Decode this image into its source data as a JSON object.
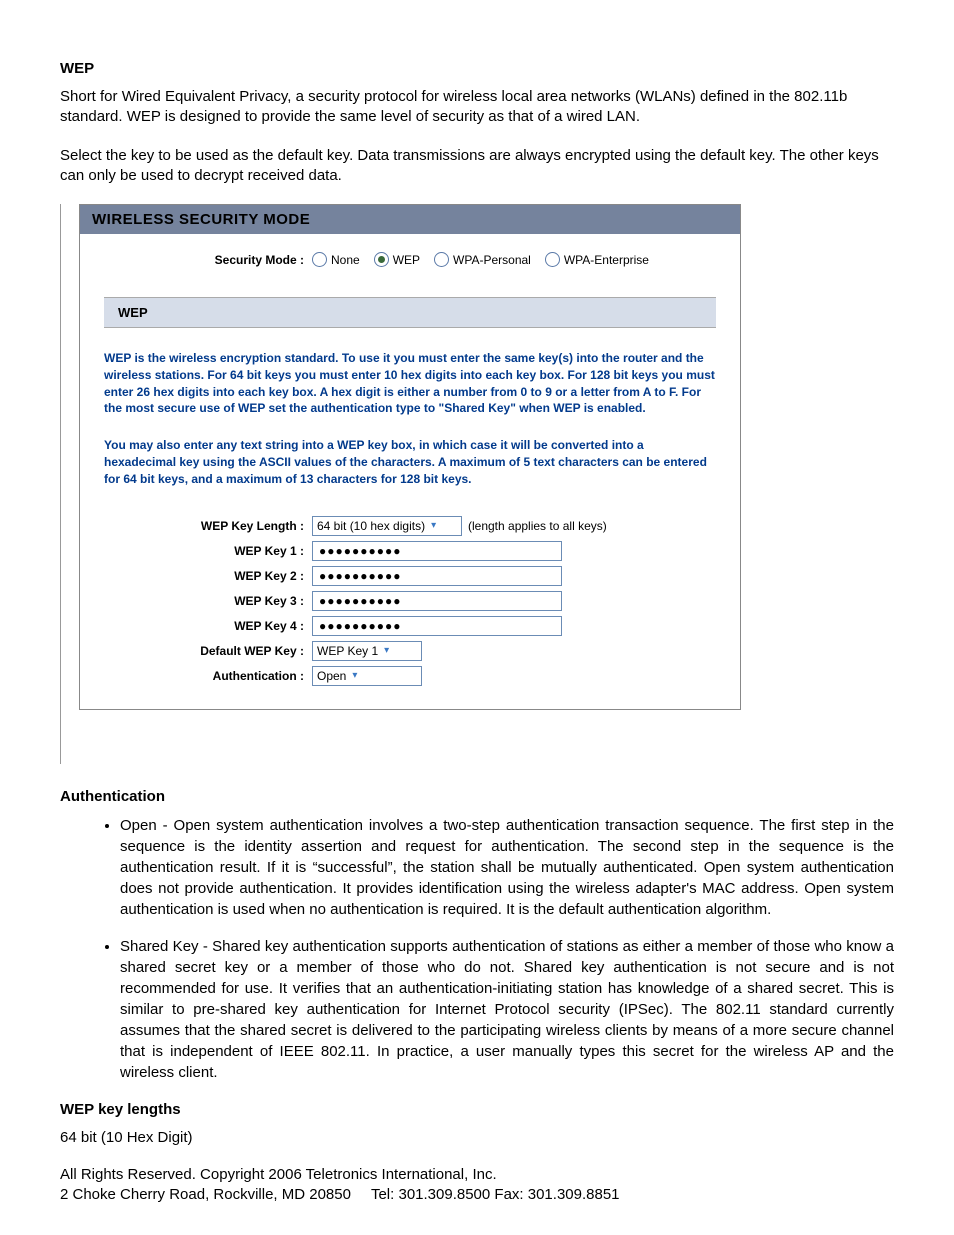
{
  "heading": "WEP",
  "intro1": "Short for Wired Equivalent Privacy, a security protocol for wireless local area networks (WLANs) defined in the 802.11b standard. WEP is designed to provide the same level of security as that of a wired LAN.",
  "intro2": "Select the key to be used as the default key. Data transmissions are always encrypted using the default key. The other keys can only be used to decrypt received data.",
  "panel": {
    "title": "WIRELESS SECURITY MODE",
    "modeLabel": "Security Mode :",
    "modes": {
      "none": "None",
      "wep": "WEP",
      "wpap": "WPA-Personal",
      "wpae": "WPA-Enterprise"
    },
    "section": "WEP",
    "info1": "WEP is the wireless encryption standard. To use it you must enter the same key(s) into the router and the wireless stations. For 64 bit keys you must enter 10 hex digits into each key box. For 128 bit keys you must enter 26 hex digits into each key box. A hex digit is either a number from 0 to 9 or a letter from A to F. For the most secure use of WEP set the authentication type to \"Shared Key\" when WEP is enabled.",
    "info2": "You may also enter any text string into a WEP key box, in which case it will be converted into a hexadecimal key using the ASCII values of the characters. A maximum of 5 text characters can be entered for 64 bit keys, and a maximum of 13 characters for 128 bit keys.",
    "form": {
      "lenLabel": "WEP Key Length :",
      "lenValue": "64 bit (10 hex digits)",
      "lenNote": "(length applies to all keys)",
      "k1Label": "WEP Key 1 :",
      "k1Value": "●●●●●●●●●●",
      "k2Label": "WEP Key 2 :",
      "k2Value": "●●●●●●●●●●",
      "k3Label": "WEP Key 3 :",
      "k3Value": "●●●●●●●●●●",
      "k4Label": "WEP Key 4 :",
      "k4Value": "●●●●●●●●●●",
      "defLabel": "Default WEP Key :",
      "defValue": "WEP Key 1",
      "authLabel": "Authentication :",
      "authValue": "Open"
    }
  },
  "auth": {
    "heading": "Authentication",
    "open": "Open - Open system authentication involves a two-step authentication transaction sequence. The first step in the sequence is the identity assertion and request for authentication. The second step in the sequence is the authentication result. If it is “successful”, the station shall be mutually authenticated. Open system authentication does not provide authentication. It provides identification using the wireless adapter's MAC address. Open system authentication is used when no authentication is required. It is the default authentication algorithm.",
    "shared": "Shared Key - Shared key authentication supports authentication of stations as either a member of those who know a shared secret key or a member of those who do not. Shared key authentication is not secure and is not recommended for use. It verifies that an authentication-initiating station has knowledge of a shared secret. This is similar to pre-shared key authentication for Internet Protocol security (IPSec). The 802.11 standard currently assumes that the shared secret is delivered to the participating wireless clients by means of a more secure channel that is independent of IEEE 802.11. In practice, a user manually types this secret for the wireless AP and the wireless client."
  },
  "keylen": {
    "heading": "WEP key lengths",
    "line": "64 bit (10 Hex Digit)"
  },
  "footer": {
    "l1": "All Rights Reserved. Copyright 2006 Teletronics International, Inc.",
    "l2a": "2 Choke Cherry Road, Rockville, MD 20850",
    "l2b": "Tel: 301.309.8500 Fax: 301.309.8851"
  }
}
